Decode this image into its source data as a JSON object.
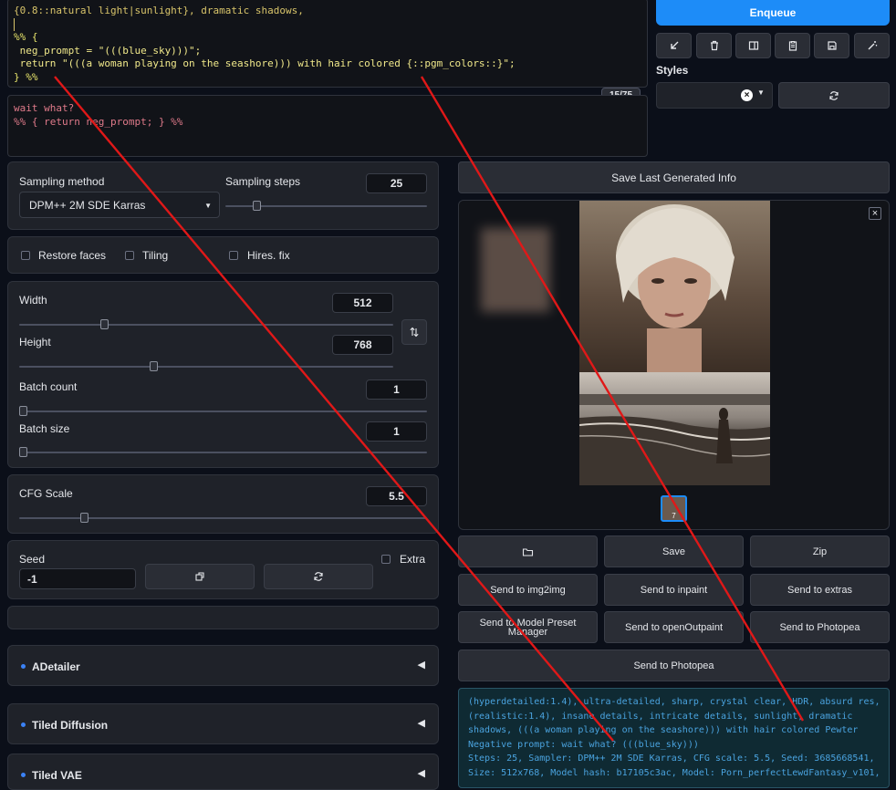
{
  "prompt": {
    "line1": "{0.8::natural light|sunlight}, dramatic shadows,",
    "line3": "%% {",
    "line4": " neg_prompt = \"(((blue_sky)))\";",
    "line5": " return \"(((a woman playing on the seashore))) with hair colored {::pgm_colors::}\";",
    "line6": "} %%",
    "token_count": "15/75"
  },
  "negative_prompt": {
    "line1": "wait what?",
    "line2": "%% { return neg_prompt; } %%"
  },
  "toolbar": {
    "enqueue_label": "Enqueue",
    "styles_label": "Styles"
  },
  "sampling": {
    "method_label": "Sampling method",
    "method_value": "DPM++ 2M SDE Karras",
    "steps_label": "Sampling steps",
    "steps_value": "25",
    "steps_fraction": 0.16
  },
  "options": {
    "restore_faces": "Restore faces",
    "tiling": "Tiling",
    "hires_fix": "Hires. fix"
  },
  "size": {
    "width_label": "Width",
    "width_value": "512",
    "width_fraction": 0.23,
    "height_label": "Height",
    "height_value": "768",
    "height_fraction": 0.36,
    "batch_count_label": "Batch count",
    "batch_count_value": "1",
    "batch_size_label": "Batch size",
    "batch_size_value": "1"
  },
  "cfg": {
    "label": "CFG Scale",
    "value": "5.5",
    "fraction": 0.16
  },
  "seed": {
    "label": "Seed",
    "value": "-1",
    "extra_label": "Extra"
  },
  "accordions": [
    "ADetailer",
    "Tiled Diffusion",
    "Tiled VAE"
  ],
  "output": {
    "save_info_label": "Save Last Generated Info",
    "buttons_row1": [
      "",
      "Save",
      "Zip"
    ],
    "buttons_row2": [
      "Send to img2img",
      "Send to inpaint",
      "Send to extras"
    ],
    "buttons_row3": [
      "Send to Model Preset Manager",
      "Send to openOutpaint",
      "Send to Photopea"
    ],
    "button_row4": "Send to Photopea",
    "info_lines": [
      "(hyperdetailed:1.4), ultra-detailed, sharp, crystal clear, HDR, absurd res,",
      "(realistic:1.4), insane details, intricate details, sunlight, dramatic",
      "shadows, (((a woman playing on the seashore))) with hair colored Pewter",
      "Negative prompt: wait what? (((blue_sky)))",
      "Steps: 25, Sampler: DPM++ 2M SDE Karras, CFG scale: 5.5, Seed: 3685668541,",
      "Size: 512x768, Model hash: b17105c3ac, Model: Porn_perfectLewdFantasy_v101,"
    ],
    "thumb_label": "7"
  },
  "colors": {
    "accent": "#1d8cf8",
    "annotation_red": "#e01818",
    "info_text": "#4aa3df"
  }
}
